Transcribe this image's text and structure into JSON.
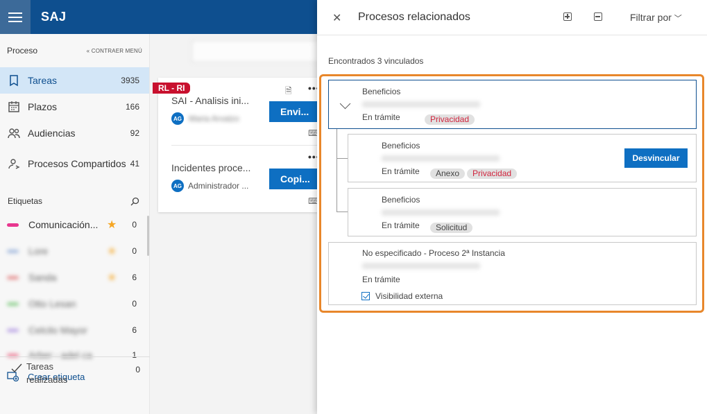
{
  "app": {
    "brand": "SAJ"
  },
  "sidebar": {
    "section_title": "Proceso",
    "collapse_label": "« CONTRAER MENÚ",
    "items": [
      {
        "label": "Tareas",
        "count": "3935",
        "icon": "bookmark-icon"
      },
      {
        "label": "Plazos",
        "count": "166",
        "icon": "calendar-icon"
      },
      {
        "label": "Audiencias",
        "count": "92",
        "icon": "people-icon"
      },
      {
        "label": "Procesos Compartidos",
        "count": "41",
        "icon": "shared-user-icon"
      }
    ],
    "tags_title": "Etiquetas",
    "tags": [
      {
        "name": "Comunicación...",
        "count": "0",
        "color": "#e8378f",
        "starred": true
      },
      {
        "name": "Lore",
        "count": "0",
        "color": "#8aa7d6",
        "starred": true
      },
      {
        "name": "Sanda",
        "count": "6",
        "color": "#e07070",
        "starred": true
      },
      {
        "name": "Otto Lesan",
        "count": "0",
        "color": "#6cc46c",
        "starred": false
      },
      {
        "name": "Celcilo Mayor",
        "count": "6",
        "color": "#a88be0",
        "starred": false
      },
      {
        "name": "Arber - adel ca",
        "count": "1",
        "color": "#e85a7a",
        "starred": false
      }
    ],
    "create_tag": "Crear etiqueta",
    "done": {
      "label": "Tareas realizadas",
      "count": "0"
    }
  },
  "tasks": [
    {
      "badge": "RL - RI",
      "title": "SAI - Analisis ini...",
      "avatar": "AG",
      "assignee": "Maria Arvalzo",
      "button": "Envi..."
    },
    {
      "title": "Incidentes proce...",
      "avatar": "AG",
      "assignee": "Administrador ...",
      "button": "Copi..."
    }
  ],
  "panel": {
    "title": "Procesos relacionados",
    "filter_label": "Filtrar por",
    "found_text": "Encontrados 3 vinculados",
    "unlink_label": "Desvincular",
    "processes": [
      {
        "type": "Beneficios",
        "number": "0000101-02.2023.8.26.0001",
        "state": "En trámite",
        "chips": [
          "Privacidad"
        ]
      },
      {
        "type": "Beneficios",
        "number": "0000102-02.2023.8.26.0002",
        "state": "En trámite",
        "chips": [
          "Anexo",
          "Privacidad"
        ]
      },
      {
        "type": "Beneficios",
        "number": "0000103-02.2023.8.26.0003",
        "state": "En trámite",
        "chips": [
          "Solicitud"
        ]
      },
      {
        "type": "No especificado - Proceso 2ª Instancia",
        "number": "0000104-02.2023.8.26.0004",
        "state": "En trámite",
        "visibility_label": "Visibilidad externa",
        "visibility_checked": true
      }
    ]
  },
  "colors": {
    "primary": "#0e4f8f",
    "button": "#0e6fc2",
    "highlight": "#e8872b",
    "badge": "#c8102e"
  }
}
